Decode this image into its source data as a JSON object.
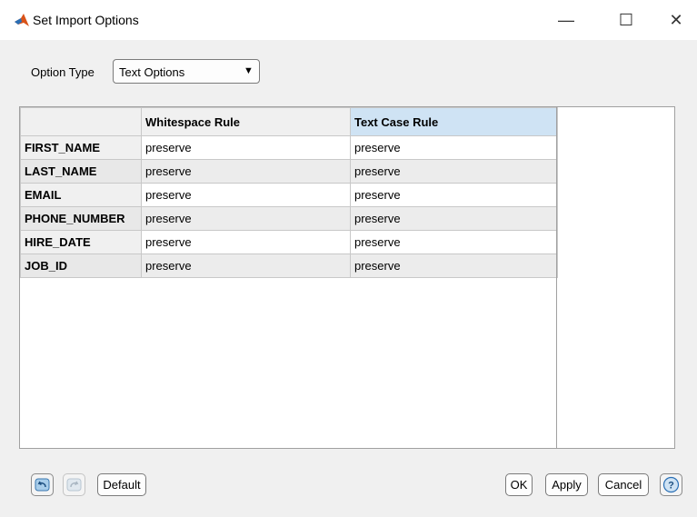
{
  "window": {
    "title": "Set Import Options",
    "controls": {
      "minimize": "—",
      "maximize": "☐",
      "close": "✕"
    }
  },
  "option_type": {
    "label": "Option Type",
    "selected": "Text Options",
    "arrow": "▼"
  },
  "table": {
    "columns": [
      "",
      "Whitespace Rule",
      "Text Case Rule"
    ],
    "selected_column": "Text Case Rule",
    "rows": [
      {
        "name": "FIRST_NAME",
        "whitespace": "preserve",
        "text_case": "preserve"
      },
      {
        "name": "LAST_NAME",
        "whitespace": "preserve",
        "text_case": "preserve"
      },
      {
        "name": "EMAIL",
        "whitespace": "preserve",
        "text_case": "preserve"
      },
      {
        "name": "PHONE_NUMBER",
        "whitespace": "preserve",
        "text_case": "preserve"
      },
      {
        "name": "HIRE_DATE",
        "whitespace": "preserve",
        "text_case": "preserve"
      },
      {
        "name": "JOB_ID",
        "whitespace": "preserve",
        "text_case": "preserve"
      }
    ]
  },
  "footer": {
    "undo_icon": "undo-icon",
    "redo_icon": "redo-icon",
    "default_label": "Default",
    "ok_label": "OK",
    "apply_label": "Apply",
    "cancel_label": "Cancel",
    "help_label": "?"
  },
  "colors": {
    "accent": "#0072bd",
    "selected_header": "#cfe3f4",
    "logo": "#d95319"
  }
}
